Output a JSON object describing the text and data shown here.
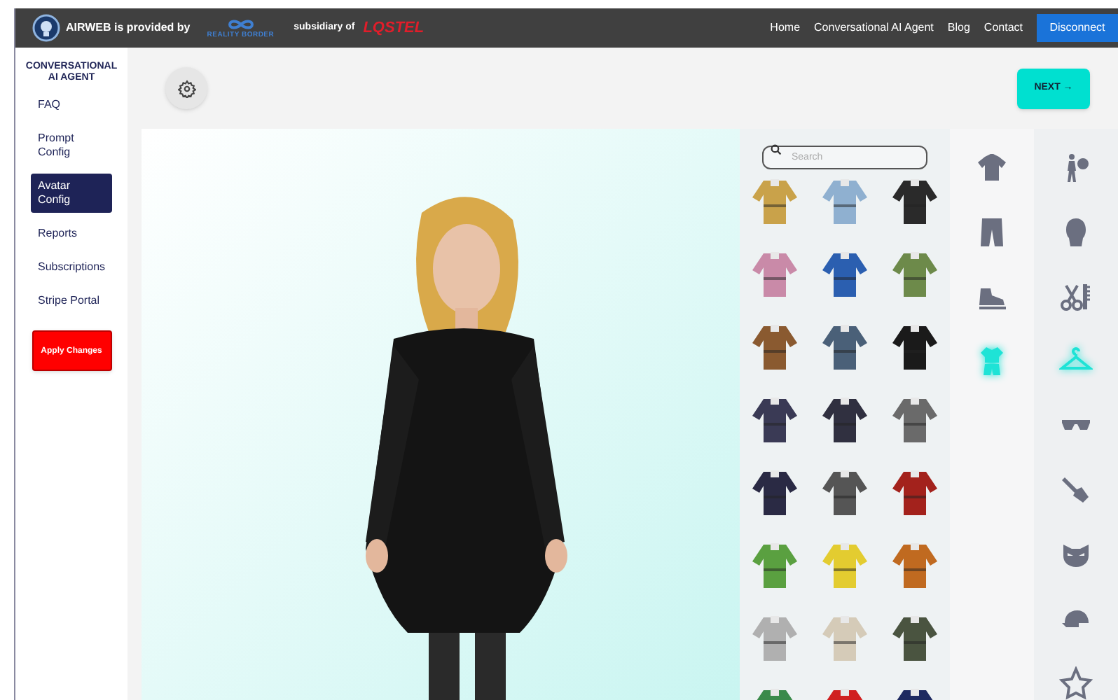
{
  "header": {
    "brand": "AIRWEB is provided by",
    "partner": "REALITY BORDER",
    "subsidiary_label": "subsidiary of",
    "parent": "LQSTEL",
    "nav": [
      "Home",
      "Conversational AI Agent",
      "Blog",
      "Contact"
    ],
    "button": "Disconnect"
  },
  "sidebar": {
    "title": "CONVERSATIONAL AI AGENT",
    "items": [
      {
        "label": "FAQ",
        "selected": false
      },
      {
        "label": "Prompt Config",
        "selected": false
      },
      {
        "label": "Avatar Config",
        "selected": true
      },
      {
        "label": "Reports",
        "selected": false
      },
      {
        "label": "Subscriptions",
        "selected": false
      },
      {
        "label": "Stripe Portal",
        "selected": false
      }
    ],
    "apply_button": "Apply Changes"
  },
  "toolbar": {
    "next_button": "NEXT →"
  },
  "wardrobe": {
    "search": {
      "placeholder": "Search"
    }
  },
  "categories_1": [
    {
      "kind": "shirt",
      "selected": false
    },
    {
      "kind": "pants",
      "selected": false
    },
    {
      "kind": "shoe",
      "selected": false
    },
    {
      "kind": "outfit",
      "selected": true
    }
  ],
  "categories_2": [
    {
      "kind": "figure",
      "selected": false
    },
    {
      "kind": "head",
      "selected": false
    },
    {
      "kind": "scissors",
      "selected": false
    },
    {
      "kind": "hanger",
      "selected": true
    },
    {
      "kind": "glasses",
      "selected": false
    },
    {
      "kind": "brush",
      "selected": false
    },
    {
      "kind": "mask",
      "selected": false
    },
    {
      "kind": "cap",
      "selected": false
    },
    {
      "kind": "star",
      "selected": false
    }
  ]
}
